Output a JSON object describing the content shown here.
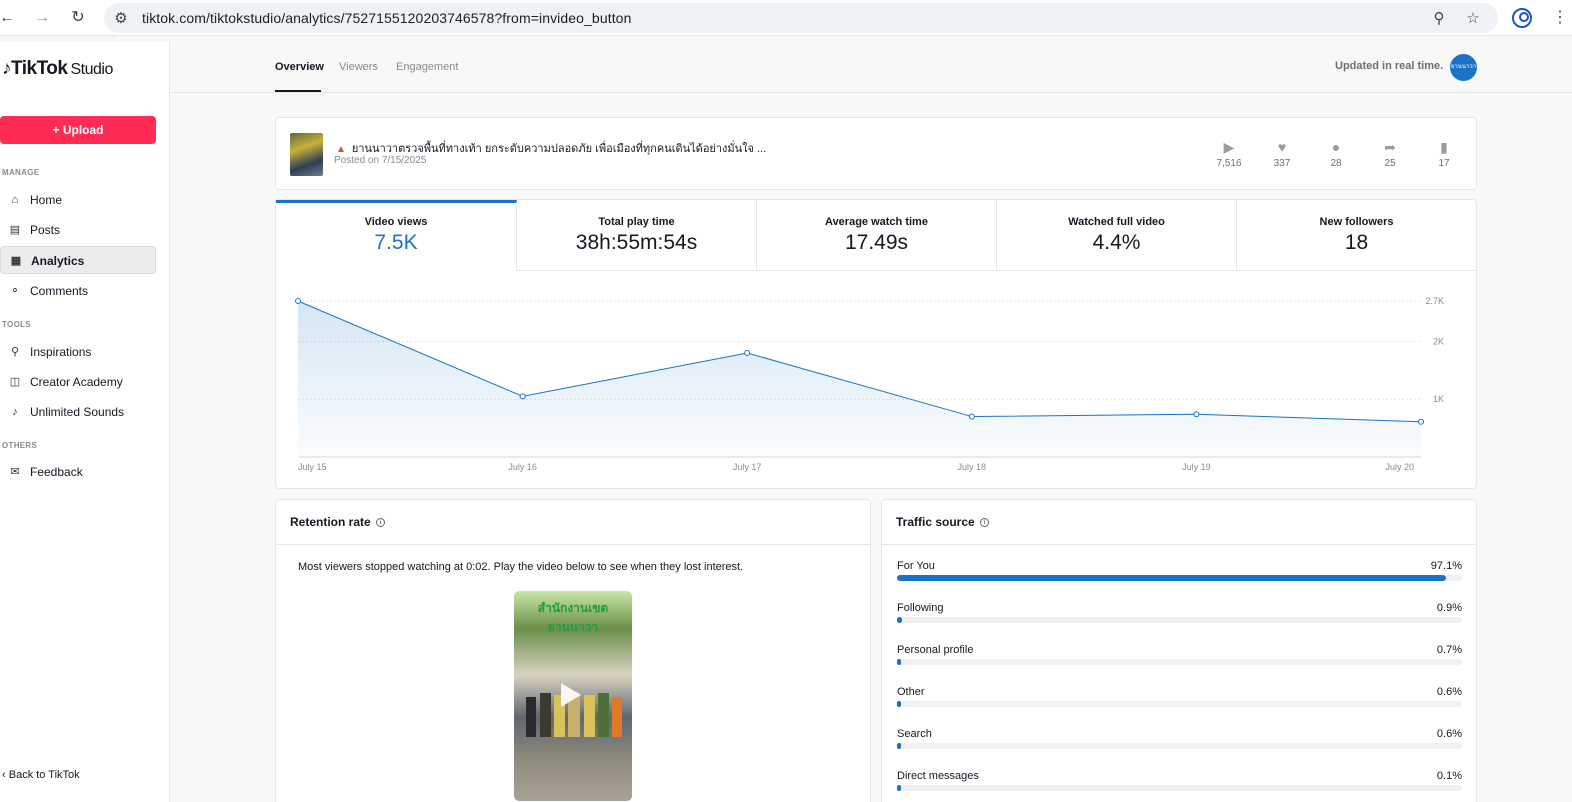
{
  "browser": {
    "url": "tiktok.com/tiktokstudio/analytics/7527155120203746578?from=invideo_button"
  },
  "sidebar": {
    "logo": "TikTok",
    "logo_suffix": "Studio",
    "upload_label": "Upload",
    "sections": {
      "manage": "MANAGE",
      "tools": "TOOLS",
      "others": "OTHERS"
    },
    "items": {
      "home": "Home",
      "posts": "Posts",
      "analytics": "Analytics",
      "comments": "Comments",
      "inspirations": "Inspirations",
      "creator_academy": "Creator Academy",
      "unlimited_sounds": "Unlimited Sounds",
      "feedback": "Feedback"
    },
    "back_label": "Back to TikTok"
  },
  "topnav": {
    "tabs": [
      "Overview",
      "Viewers",
      "Engagement"
    ],
    "active_tab": "Overview",
    "updated": "Updated in real time."
  },
  "video": {
    "title": "ยานนาวาตรวจพื้นที่ทางเท้า ยกระดับความปลอดภัย เพื่อเมืองที่ทุกคนเดินได้อย่างมั่นใจ ...",
    "posted": "Posted on 7/15/2025",
    "stats": {
      "views": "7,516",
      "likes": "337",
      "comments": "28",
      "shares": "25",
      "saves": "17"
    }
  },
  "kpis": [
    {
      "label": "Video views",
      "value": "7.5K"
    },
    {
      "label": "Total play time",
      "value": "38h:55m:54s"
    },
    {
      "label": "Average watch time",
      "value": "17.49s"
    },
    {
      "label": "Watched full video",
      "value": "4.4%"
    },
    {
      "label": "New followers",
      "value": "18"
    }
  ],
  "chart_data": {
    "type": "area",
    "categories": [
      "July 15",
      "July 16",
      "July 17",
      "July 18",
      "July 19",
      "July 20"
    ],
    "series": [
      {
        "values": [
          2700,
          1050,
          1800,
          700,
          740,
          610
        ]
      }
    ],
    "ytick_labels": [
      "2.7K",
      "2K",
      "1K"
    ],
    "ytick_values": [
      2700,
      2000,
      1000
    ],
    "ylim": [
      0,
      2700
    ],
    "grid": true,
    "color": "#1a73c8"
  },
  "retention": {
    "title": "Retention rate",
    "text": "Most viewers stopped watching at 0:02. Play the video below to see when they lost interest.",
    "video_banner": "สำนักงานเขตยานนาวา"
  },
  "traffic": {
    "title": "Traffic source",
    "rows": [
      {
        "name": "For You",
        "pct": "97.1%",
        "value": 97.1
      },
      {
        "name": "Following",
        "pct": "0.9%",
        "value": 0.9
      },
      {
        "name": "Personal profile",
        "pct": "0.7%",
        "value": 0.7
      },
      {
        "name": "Other",
        "pct": "0.6%",
        "value": 0.6
      },
      {
        "name": "Search",
        "pct": "0.6%",
        "value": 0.6
      },
      {
        "name": "Direct messages",
        "pct": "0.1%",
        "value": 0.1
      }
    ]
  }
}
